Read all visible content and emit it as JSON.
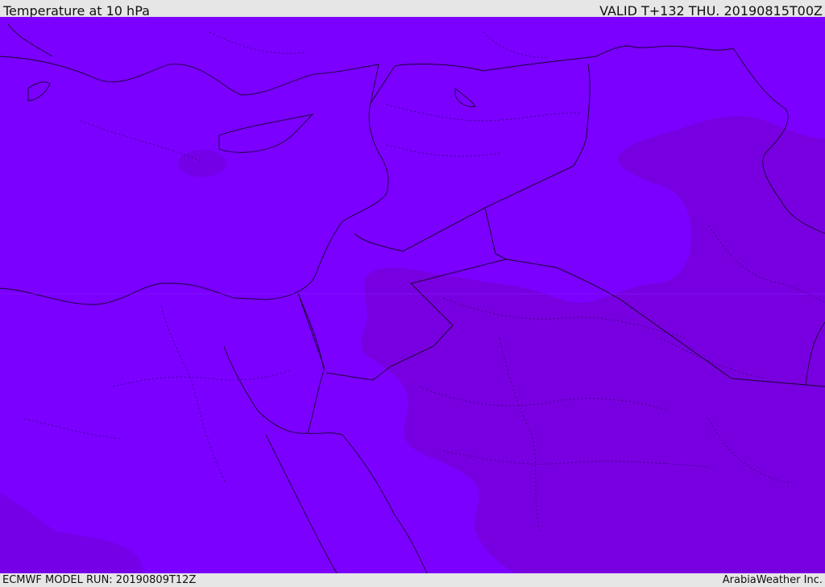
{
  "header": {
    "title": "Temperature at 10 hPa",
    "valid": "VALID T+132 THU. 20190815T00Z"
  },
  "footer": {
    "model_run": "ECMWF MODEL RUN: 20190809T12Z",
    "credit": "ArabiaWeather Inc."
  },
  "colors": {
    "field_main": "#7b00ff",
    "field_warm": "#7a00de",
    "field_patch": "#7300e6",
    "coastline": "#1a0033",
    "border": "#1a0033",
    "bar_background": "#e6e6e6"
  }
}
